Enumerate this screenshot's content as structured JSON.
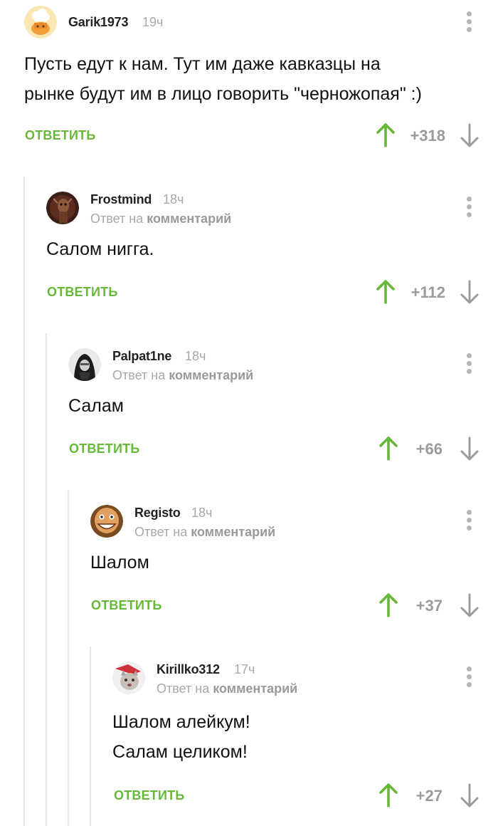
{
  "comments": [
    {
      "author": "Garik1973",
      "time": "19ч",
      "reply_prefix": "",
      "reply_link": "",
      "lines": [
        "Пусть едут к нам. Тут им даже кавказцы на",
        "рынке будут им в лицо говорить \"черножопая\" :)"
      ],
      "score": "+318",
      "reply_label": "ОТВЕТИТЬ",
      "avatar": "chef-hat-avatar"
    },
    {
      "author": "Frostmind",
      "time": "18ч",
      "reply_prefix": "Ответ на ",
      "reply_link": "комментарий",
      "lines": [
        "Салом нигга."
      ],
      "score": "+112",
      "reply_label": "ОТВЕТИТЬ",
      "avatar": "dark-figure-avatar"
    },
    {
      "author": "Palpat1ne",
      "time": "18ч",
      "reply_prefix": "Ответ на ",
      "reply_link": "комментарий",
      "lines": [
        "Салам"
      ],
      "score": "+66",
      "reply_label": "ОТВЕТИТЬ",
      "avatar": "hooded-figure-avatar"
    },
    {
      "author": "Registo",
      "time": "18ч",
      "reply_prefix": "Ответ на ",
      "reply_link": "комментарий",
      "lines": [
        "Шалом"
      ],
      "score": "+37",
      "reply_label": "ОТВЕТИТЬ",
      "avatar": "smiling-face-avatar"
    },
    {
      "author": "Kirillko312",
      "time": "17ч",
      "reply_prefix": "Ответ на ",
      "reply_link": "комментарий",
      "lines": [
        "Шалом алейкум!",
        "Салам целиком!"
      ],
      "score": "+27",
      "reply_label": "ОТВЕТИТЬ",
      "avatar": "cat-avatar"
    }
  ],
  "colors": {
    "accent_green": "#67b83a",
    "muted_gray": "#a8a8a8",
    "thread_line": "#e6e6e6"
  },
  "icons": {
    "upvote": "arrow-up-icon",
    "downvote": "arrow-down-icon",
    "more": "more-vertical-icon"
  }
}
